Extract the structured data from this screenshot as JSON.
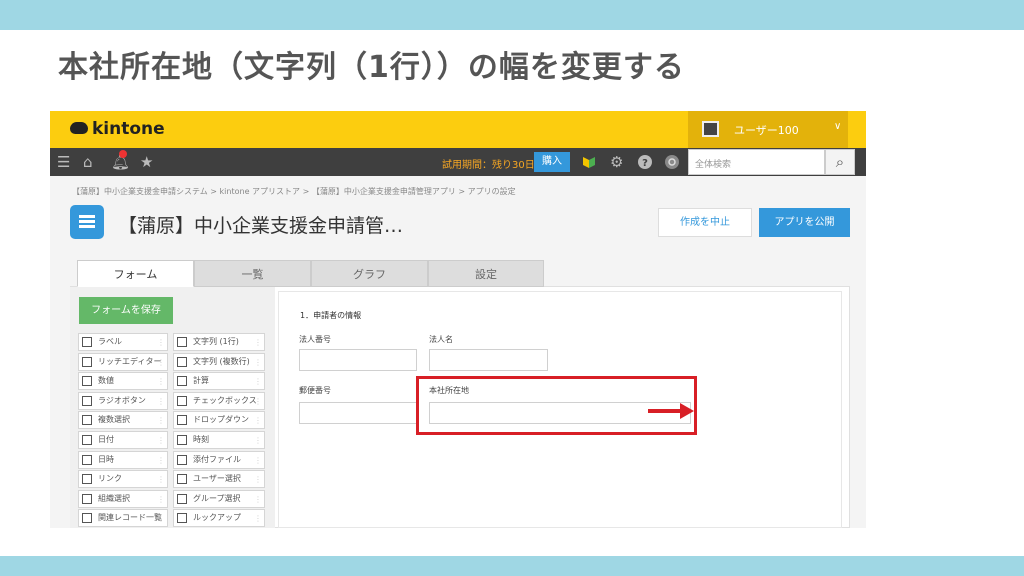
{
  "slide": {
    "title": "本社所在地（文字列（1行））の幅を変更する",
    "band_color": "#9fd7e4"
  },
  "kintone": {
    "logo": "kintone",
    "user_name": "ユーザー100",
    "user_chevron": "∨",
    "nav_icons": [
      "menu-icon",
      "home-icon",
      "bell-icon",
      "star-icon"
    ],
    "trial_text": "試用期間：残り30日",
    "buy_label": "購入",
    "search_placeholder": "全体検索",
    "breadcrumb": "【蒲原】中小企業支援金申請システム  >  kintone アプリストア  >  【蒲原】中小企業支援金申請管理アプリ  >  アプリの設定",
    "app_title": "【蒲原】中小企業支援金申請管…",
    "cancel_label": "作成を中止",
    "publish_label": "アプリを公開",
    "tabs": [
      "フォーム",
      "一覧",
      "グラフ",
      "設定"
    ],
    "save_form_label": "フォームを保存",
    "palette": [
      "ラベル",
      "文字列 (1行)",
      "リッチエディター",
      "文字列 (複数行)",
      "数値",
      "計算",
      "ラジオボタン",
      "チェックボックス",
      "複数選択",
      "ドロップダウン",
      "日付",
      "時刻",
      "日時",
      "添付ファイル",
      "リンク",
      "ユーザー選択",
      "組織選択",
      "グループ選択",
      "関連レコード一覧",
      "ルックアップ"
    ],
    "section_label": "1．申請者の情報",
    "fields": {
      "corp_number": "法人番号",
      "corp_name": "法人名",
      "postal_code": "郵便番号",
      "hq_address": "本社所在地"
    },
    "accent_blue": "#3498db",
    "header_yellow": "#fccd0f",
    "save_green": "#64b868",
    "highlight_red": "#d81f26"
  }
}
